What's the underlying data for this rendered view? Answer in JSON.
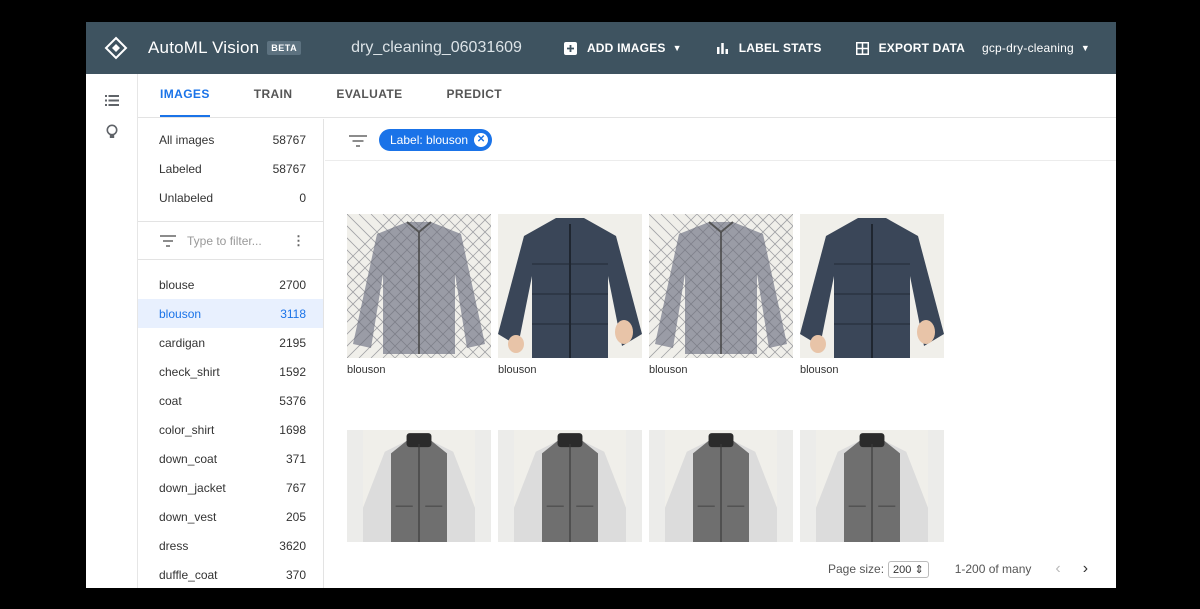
{
  "header": {
    "app_title": "AutoML Vision",
    "beta_badge": "BETA",
    "dataset_name": "dry_cleaning_06031609",
    "add_images": "ADD IMAGES",
    "label_stats": "LABEL STATS",
    "export_data": "EXPORT DATA",
    "project": "gcp-dry-cleaning"
  },
  "tabs": [
    "IMAGES",
    "TRAIN",
    "EVALUATE",
    "PREDICT"
  ],
  "active_tab": "IMAGES",
  "counts": [
    {
      "label": "All images",
      "count": "58767"
    },
    {
      "label": "Labeled",
      "count": "58767"
    },
    {
      "label": "Unlabeled",
      "count": "0"
    }
  ],
  "filter": {
    "placeholder": "Type to filter..."
  },
  "labels": [
    {
      "name": "blouse",
      "count": "2700"
    },
    {
      "name": "blouson",
      "count": "3118"
    },
    {
      "name": "cardigan",
      "count": "2195"
    },
    {
      "name": "check_shirt",
      "count": "1592"
    },
    {
      "name": "coat",
      "count": "5376"
    },
    {
      "name": "color_shirt",
      "count": "1698"
    },
    {
      "name": "down_coat",
      "count": "371"
    },
    {
      "name": "down_jacket",
      "count": "767"
    },
    {
      "name": "down_vest",
      "count": "205"
    },
    {
      "name": "dress",
      "count": "3620"
    },
    {
      "name": "duffle_coat",
      "count": "370"
    }
  ],
  "active_label": "blouson",
  "chip": {
    "text": "Label: blouson"
  },
  "images": [
    {
      "caption": "blouson",
      "style": "quilted-grey"
    },
    {
      "caption": "blouson",
      "style": "navy-puffer"
    },
    {
      "caption": "blouson",
      "style": "quilted-grey"
    },
    {
      "caption": "blouson",
      "style": "navy-puffer"
    },
    {
      "caption": "",
      "style": "grey-white-sleeve"
    },
    {
      "caption": "",
      "style": "grey-white-sleeve"
    },
    {
      "caption": "",
      "style": "grey-white-sleeve"
    },
    {
      "caption": "",
      "style": "grey-white-sleeve"
    }
  ],
  "pager": {
    "size_label": "Page size:",
    "size_value": "200",
    "range": "1-200 of many"
  },
  "colors": {
    "header_bg": "#3e5360",
    "accent": "#1a73e8",
    "active_row_bg": "#e8f0fe"
  }
}
